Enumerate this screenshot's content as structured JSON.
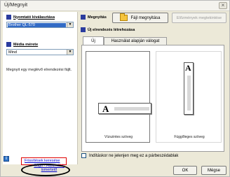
{
  "window": {
    "title": "Új/Megnyit",
    "close_glyph": "×"
  },
  "left": {
    "printer_label": "Nyomtató kiválasztása",
    "printer_value": "Brother QL-570",
    "media_label": "Média mérete",
    "media_value": "Mind",
    "info_text": "Megnyit egy meglévő elrendezési fájlt.",
    "support_link": "Frissítések keresése",
    "support_link2": "Súgó - Használati ismertető"
  },
  "right": {
    "open_label": "Megnyitás",
    "open_file_button": "Fájl megnyitása",
    "history_button": "Előzmények megtekintése",
    "new_layout_label": "Új elrendezés létrehozása",
    "tabs": [
      "Új",
      "Használat alapján válogat"
    ],
    "cards": [
      {
        "caption": "Vízszintes szöveg",
        "glyph": "A"
      },
      {
        "caption": "Függőleges szöveg",
        "glyph": "A"
      }
    ],
    "checkbox_label": "Indításkor ne jelenjen meg ez a párbeszédablak"
  },
  "footer": {
    "ok": "OK",
    "cancel": "Mégse"
  },
  "colors": {
    "accent": "#2b3c9e",
    "highlight_red": "#e00000",
    "link": "#0000cc"
  }
}
